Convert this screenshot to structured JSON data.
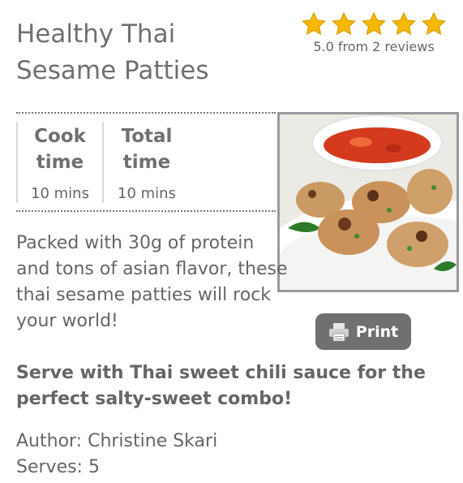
{
  "recipe": {
    "title_line1": "Healthy Thai",
    "title_line2": "Sesame Patties",
    "rating": {
      "stars": 5,
      "text": "5.0 from 2 reviews",
      "star_color": "#f5b800"
    },
    "times": {
      "cook": {
        "label_line1": "Cook",
        "label_line2": "time",
        "value": "10 mins"
      },
      "total": {
        "label_line1": "Total",
        "label_line2": "time",
        "value": "10 mins"
      }
    },
    "description": "Packed with 30g of protein and tons of asian flavor, these thai sesame patties will rock your world!",
    "serving_note": "Serve with Thai sweet chili sauce for the perfect salty-sweet combo!",
    "author": "Author: Christine Skari",
    "serves": "Serves: 5",
    "print_label": "Print"
  },
  "icons": {
    "star": "star-icon",
    "print": "printer-icon"
  }
}
